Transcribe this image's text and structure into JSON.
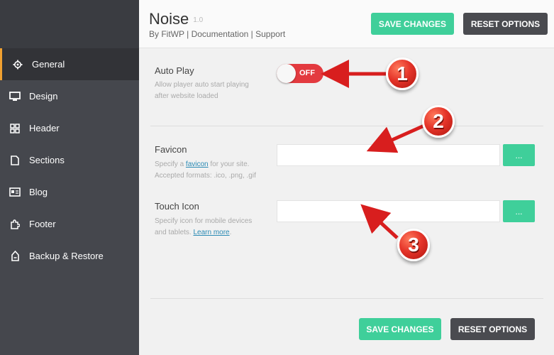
{
  "header": {
    "title": "Noise",
    "version": "1.0",
    "by": "By FitWP",
    "sep": "|",
    "documentation": "Documentation",
    "support": "Support",
    "save_label": "SAVE CHANGES",
    "reset_label": "RESET OPTIONS"
  },
  "sidebar": {
    "items": [
      {
        "label": "General",
        "icon": "gear-icon"
      },
      {
        "label": "Design",
        "icon": "monitor-icon"
      },
      {
        "label": "Header",
        "icon": "grid-icon"
      },
      {
        "label": "Sections",
        "icon": "page-icon"
      },
      {
        "label": "Blog",
        "icon": "blog-icon"
      },
      {
        "label": "Footer",
        "icon": "puzzle-icon"
      },
      {
        "label": "Backup & Restore",
        "icon": "restore-icon"
      }
    ]
  },
  "options": {
    "autoplay": {
      "label": "Auto Play",
      "desc_line1": "Allow player auto start playing",
      "desc_line2": "after website loaded",
      "toggle_state": "OFF"
    },
    "favicon": {
      "label": "Favicon",
      "desc_pre": "Specify a ",
      "desc_link": "favicon",
      "desc_post": " for your site.",
      "desc_line2": "Accepted formats: .ico, .png, .gif",
      "value": "",
      "button": "..."
    },
    "touch_icon": {
      "label": "Touch Icon",
      "desc_line1": "Specify icon for mobile devices",
      "desc_pre2": "and tablets. ",
      "desc_link": "Learn more",
      "desc_post2": ".",
      "value": "",
      "button": "..."
    }
  },
  "footer": {
    "save_label": "SAVE CHANGES",
    "reset_label": "RESET OPTIONS"
  },
  "callouts": [
    "1",
    "2",
    "3"
  ],
  "colors": {
    "accent_green": "#3fcf9a",
    "toggle_red": "#e33a3f",
    "sidebar_bg": "#45474d",
    "active_indicator": "#f0a030"
  }
}
